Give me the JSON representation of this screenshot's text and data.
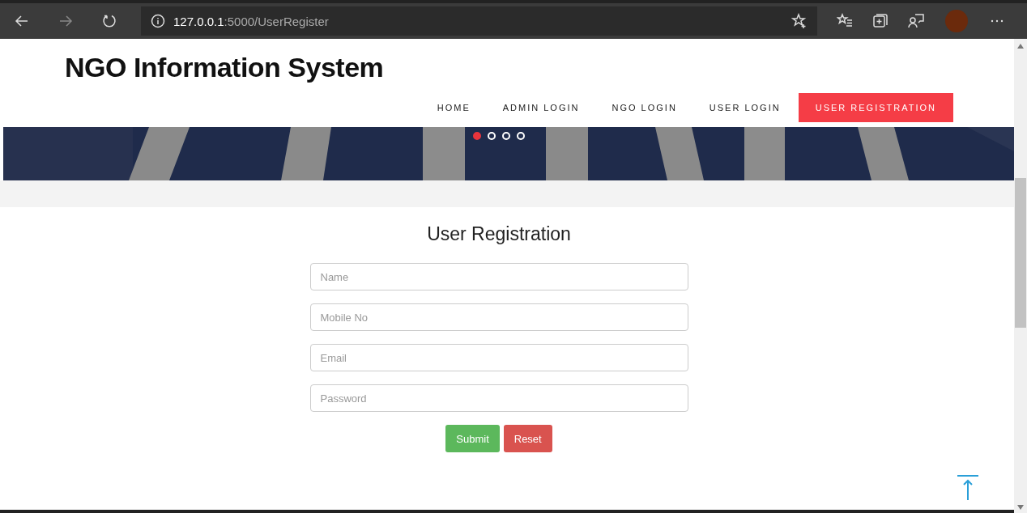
{
  "browser": {
    "url_host": "127.0.0.1",
    "url_path": ":5000/UserRegister"
  },
  "site": {
    "title": "NGO Information System",
    "nav": [
      {
        "label": "HOME",
        "selected": false
      },
      {
        "label": "ADMIN LOGIN",
        "selected": false
      },
      {
        "label": "NGO LOGIN",
        "selected": false
      },
      {
        "label": "USER LOGIN",
        "selected": false
      },
      {
        "label": "USER REGISTRATION",
        "selected": true
      }
    ]
  },
  "banner": {
    "kind": "picture",
    "dots": [
      {
        "selected": true
      },
      {
        "selected": false
      },
      {
        "selected": false
      },
      {
        "selected": false
      }
    ]
  },
  "form": {
    "heading": "User Registration",
    "fields": [
      {
        "placeholder": "Name"
      },
      {
        "placeholder": "Mobile No"
      },
      {
        "placeholder": "Email"
      },
      {
        "placeholder": "Password"
      }
    ],
    "buttons": [
      {
        "label": "Submit",
        "kind": "submit"
      },
      {
        "label": "Reset",
        "kind": "reset"
      }
    ]
  }
}
